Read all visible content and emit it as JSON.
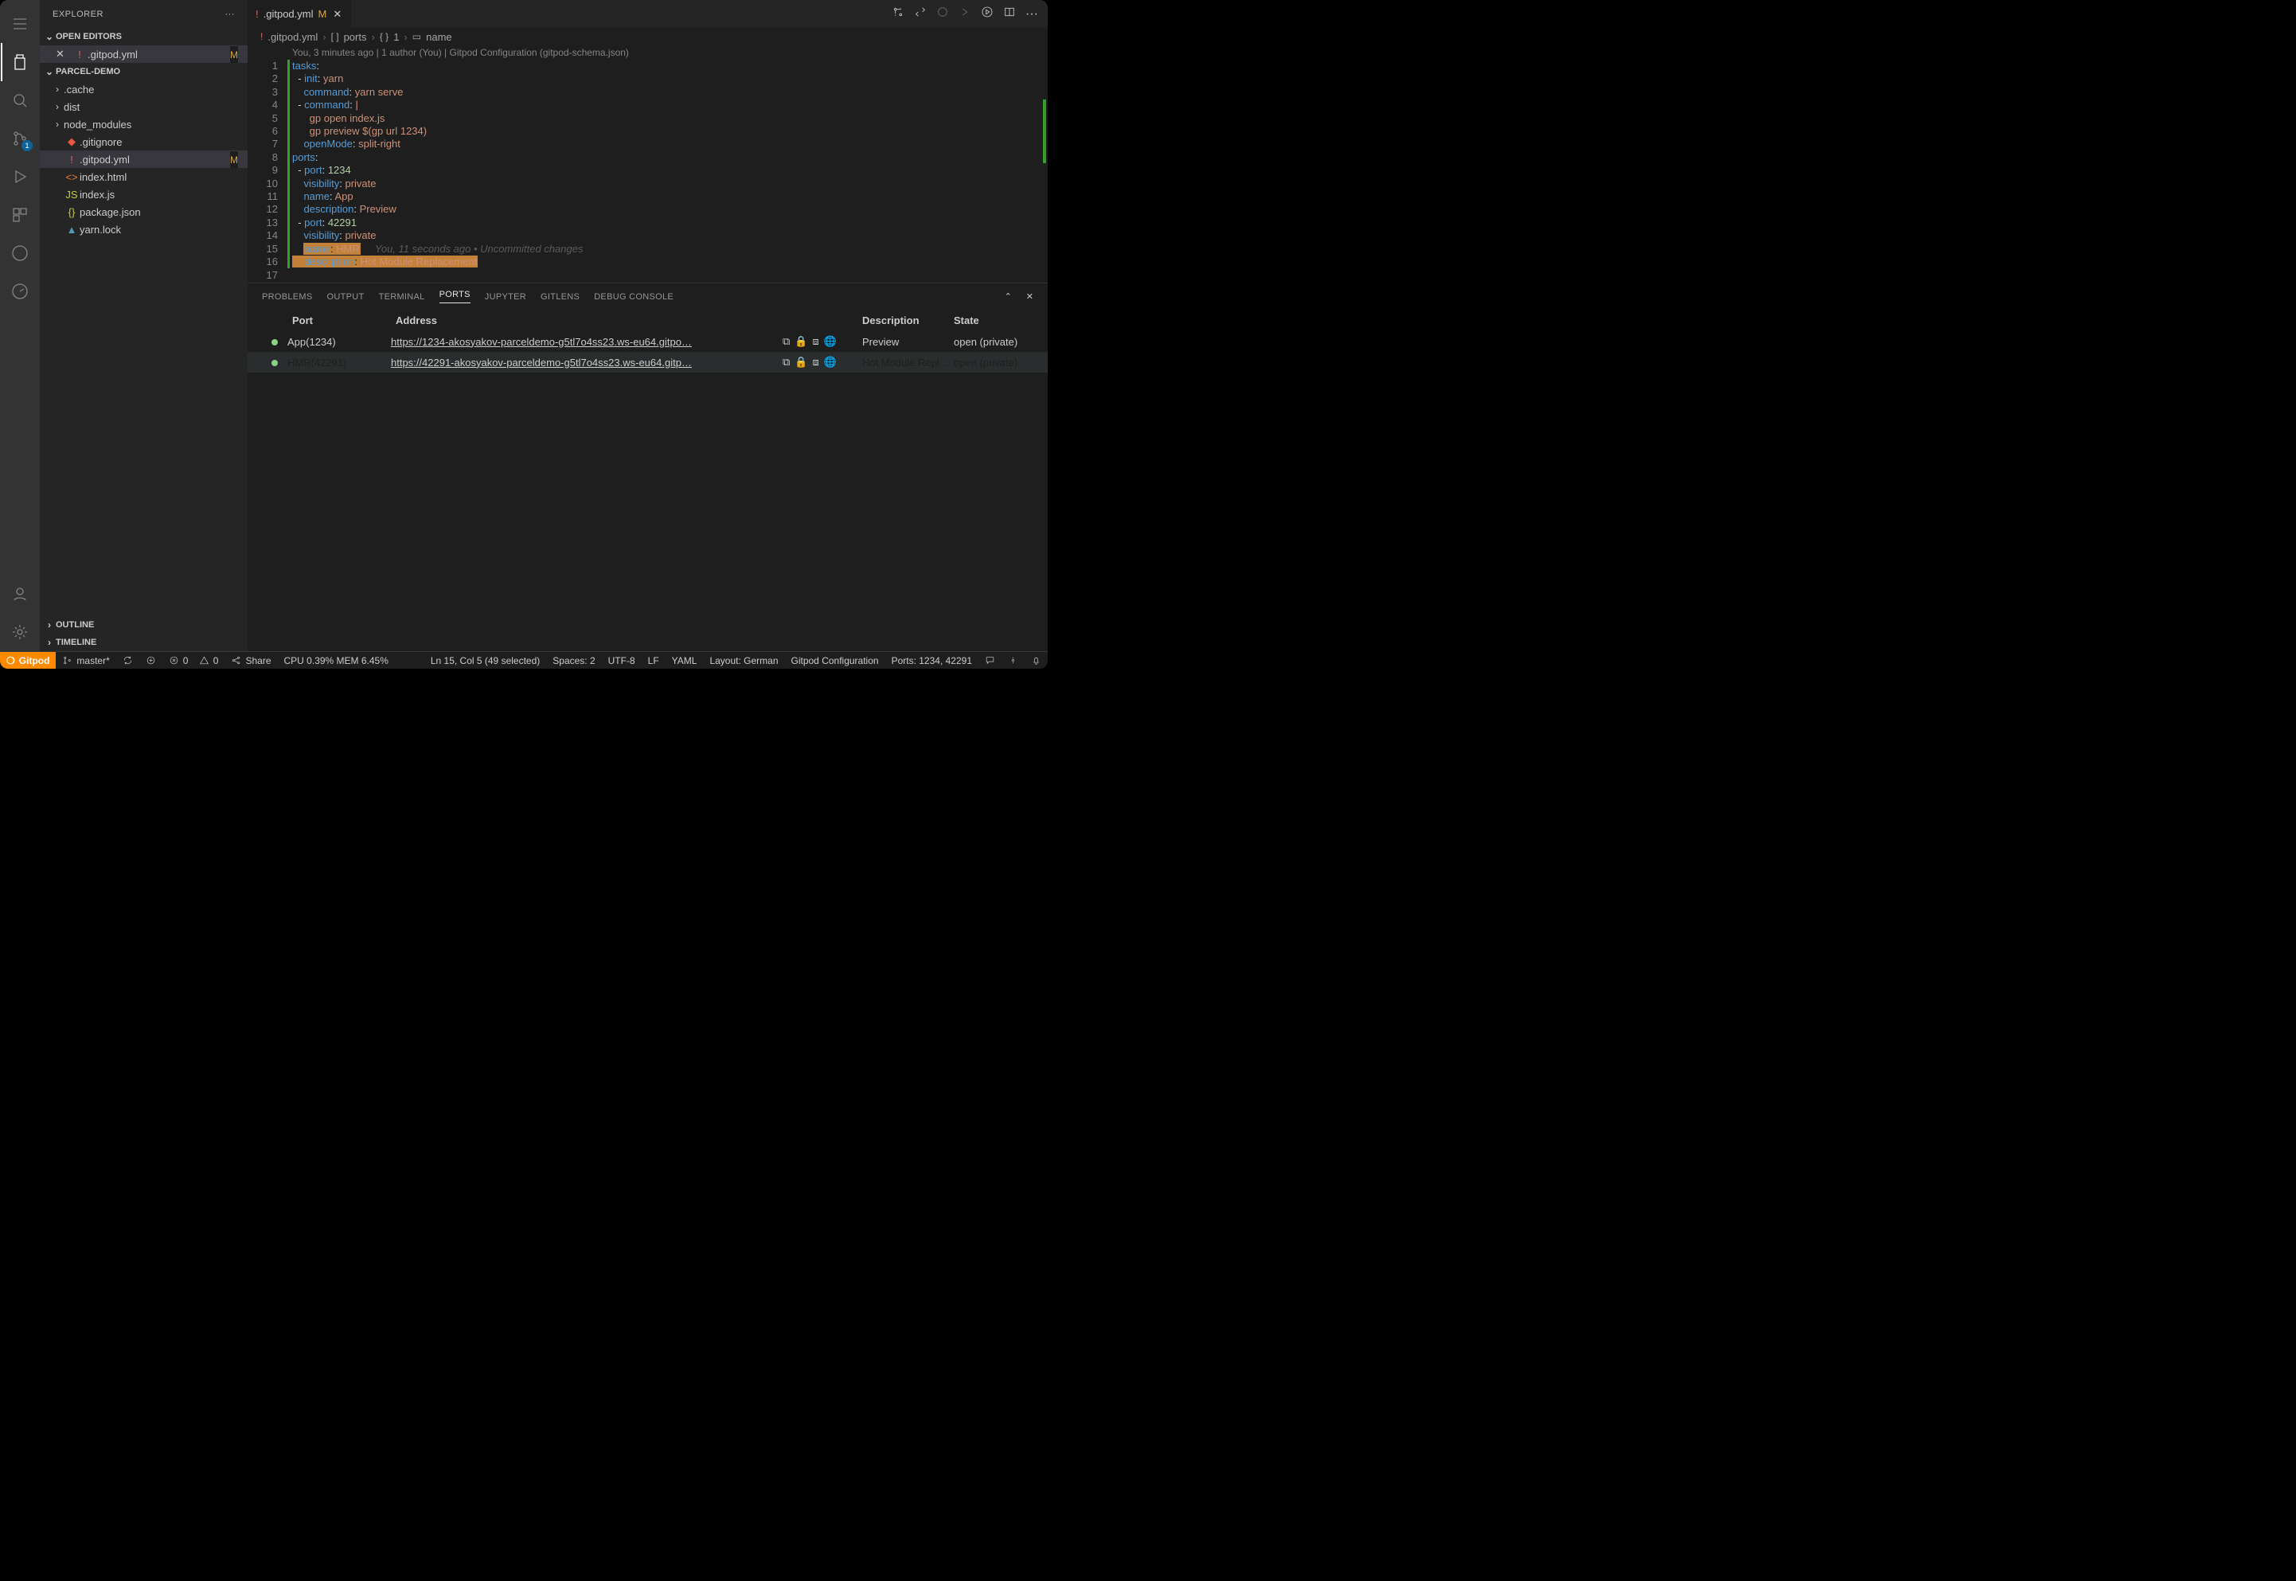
{
  "sidebar": {
    "title": "EXPLORER",
    "openEditorsLabel": "OPEN EDITORS",
    "projectLabel": "PARCEL-DEMO",
    "outlineLabel": "OUTLINE",
    "timelineLabel": "TIMELINE",
    "openEditors": [
      {
        "icon": "!",
        "label": ".gitpod.yml",
        "status": "M"
      }
    ],
    "tree": [
      {
        "kind": "folder",
        "label": ".cache"
      },
      {
        "kind": "folder",
        "label": "dist"
      },
      {
        "kind": "folder",
        "label": "node_modules"
      },
      {
        "kind": "file",
        "iconCls": "fi-git",
        "icon": "◆",
        "label": ".gitignore"
      },
      {
        "kind": "file",
        "iconCls": "fi-yml",
        "icon": "!",
        "label": ".gitpod.yml",
        "status": "M",
        "active": true
      },
      {
        "kind": "file",
        "iconCls": "fi-html",
        "icon": "<>",
        "label": "index.html"
      },
      {
        "kind": "file",
        "iconCls": "fi-js",
        "icon": "JS",
        "label": "index.js"
      },
      {
        "kind": "file",
        "iconCls": "fi-json",
        "icon": "{}",
        "label": "package.json"
      },
      {
        "kind": "file",
        "iconCls": "fi-lock",
        "icon": "▲",
        "label": "yarn.lock"
      }
    ]
  },
  "scmBadge": "1",
  "tab": {
    "icon": "!",
    "label": ".gitpod.yml",
    "status": "M"
  },
  "breadcrumb": {
    "file": ".gitpod.yml",
    "p1": "ports",
    "p2": "1",
    "p3": "name"
  },
  "codelens": "You, 3 minutes ago | 1 author (You) | Gitpod Configuration (gitpod-schema.json)",
  "code": {
    "tasks": "tasks",
    "init": "init",
    "yarn": "yarn",
    "command": "command",
    "yarnServe": "yarn serve",
    "pipe": "|",
    "gpOpen": "gp open index.js",
    "gpPreview": "gp preview $(gp url 1234)",
    "openMode": "openMode",
    "splitRight": "split-right",
    "ports": "ports",
    "port": "port",
    "p1234": "1234",
    "visibility": "visibility",
    "private": "private",
    "name": "name",
    "app": "App",
    "description": "description",
    "preview": "Preview",
    "p42291": "42291",
    "hmr": "HMR",
    "hmrDesc": "Hot Module Replacement",
    "lens2": "You, 11 seconds ago • Uncommitted changes"
  },
  "panel": {
    "tabs": {
      "problems": "PROBLEMS",
      "output": "OUTPUT",
      "terminal": "TERMINAL",
      "ports": "PORTS",
      "jupyter": "JUPYTER",
      "gitlens": "GITLENS",
      "debug": "DEBUG CONSOLE"
    },
    "hdr": {
      "port": "Port",
      "addr": "Address",
      "desc": "Description",
      "state": "State"
    },
    "rows": [
      {
        "name": "App(1234)",
        "addr": "https://1234-akosyakov-parceldemo-g5tl7o4ss23.ws-eu64.gitpo…",
        "desc": "Preview",
        "state": "open (private)"
      },
      {
        "name": "HMR(42291)",
        "addr": "https://42291-akosyakov-parceldemo-g5tl7o4ss23.ws-eu64.gitp…",
        "desc": "Hot Module Repl…",
        "state": "open (private)",
        "sel": true
      }
    ]
  },
  "status": {
    "gitpod": "Gitpod",
    "branch": "master*",
    "err": "0",
    "warn": "0",
    "share": "Share",
    "cpu": "CPU 0.39% MEM 6.45%",
    "pos": "Ln 15, Col 5 (49 selected)",
    "spaces": "Spaces: 2",
    "enc": "UTF-8",
    "eol": "LF",
    "lang": "YAML",
    "layout": "Layout: German",
    "gpconf": "Gitpod Configuration",
    "ports": "Ports: 1234, 42291"
  }
}
